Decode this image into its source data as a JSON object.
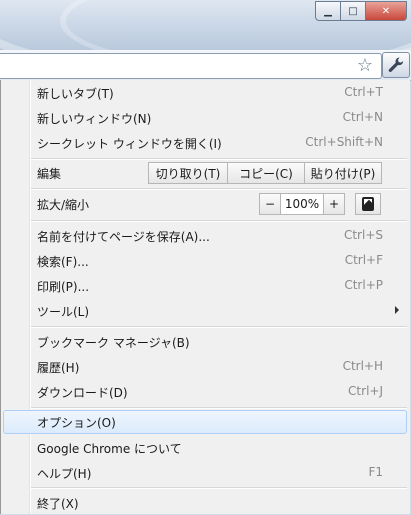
{
  "window": {
    "controls": {
      "minimize": "▁",
      "maximize": "□",
      "close": "✕"
    }
  },
  "toolbar": {
    "star_icon": "☆",
    "wrench_icon": "wrench-icon"
  },
  "menu": {
    "new_tab": {
      "label": "新しいタブ(T)",
      "accel": "Ctrl+T"
    },
    "new_window": {
      "label": "新しいウィンドウ(N)",
      "accel": "Ctrl+N"
    },
    "incognito": {
      "label": "シークレット ウィンドウを開く(I)",
      "accel": "Ctrl+Shift+N"
    },
    "edit": {
      "label": "編集",
      "cut": "切り取り(T)",
      "copy": "コピー(C)",
      "paste": "貼り付け(P)"
    },
    "zoom": {
      "label": "拡大/縮小",
      "minus": "−",
      "value": "100%",
      "plus": "+"
    },
    "save_page": {
      "label": "名前を付けてページを保存(A)...",
      "accel": "Ctrl+S"
    },
    "find": {
      "label": "検索(F)...",
      "accel": "Ctrl+F"
    },
    "print": {
      "label": "印刷(P)...",
      "accel": "Ctrl+P"
    },
    "tools": {
      "label": "ツール(L)"
    },
    "bookmarks": {
      "label": "ブックマーク マネージャ(B)"
    },
    "history": {
      "label": "履歴(H)",
      "accel": "Ctrl+H"
    },
    "downloads": {
      "label": "ダウンロード(D)",
      "accel": "Ctrl+J"
    },
    "options": {
      "label": "オプション(O)"
    },
    "about": {
      "label": "Google Chrome について"
    },
    "help": {
      "label": "ヘルプ(H)",
      "accel": "F1"
    },
    "exit": {
      "label": "終了(X)"
    }
  }
}
